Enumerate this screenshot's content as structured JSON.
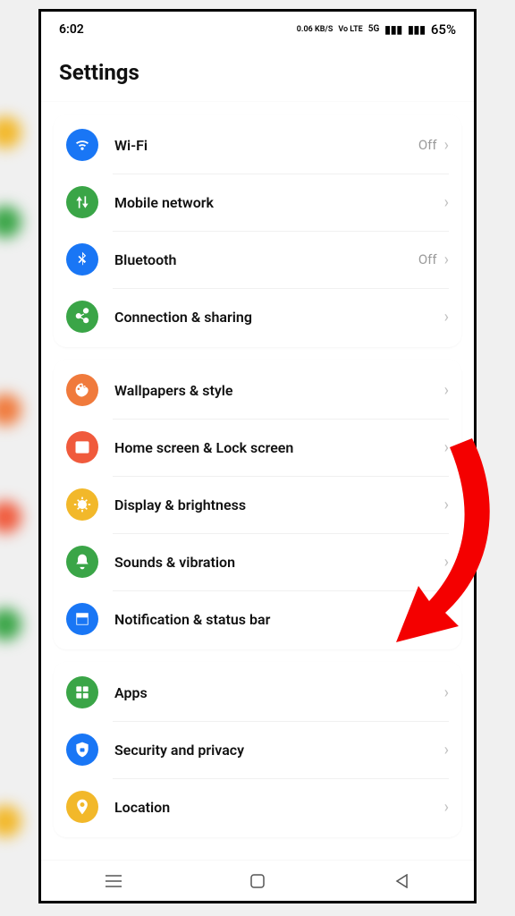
{
  "statusBar": {
    "time": "6:02",
    "netspeed": "0.06 KB/S",
    "volte": "Vo LTE",
    "net": "5G",
    "battery": "65%"
  },
  "header": {
    "title": "Settings"
  },
  "groups": [
    {
      "items": [
        {
          "icon": "wifi-icon",
          "color": "#1976f5",
          "label": "Wi-Fi",
          "value": "Off"
        },
        {
          "icon": "mobile-network-icon",
          "color": "#3aa547",
          "label": "Mobile network",
          "value": ""
        },
        {
          "icon": "bluetooth-icon",
          "color": "#1976f5",
          "label": "Bluetooth",
          "value": "Off"
        },
        {
          "icon": "connection-sharing-icon",
          "color": "#3aa547",
          "label": "Connection & sharing",
          "value": ""
        }
      ]
    },
    {
      "items": [
        {
          "icon": "wallpapers-icon",
          "color": "#f07a3c",
          "label": "Wallpapers & style",
          "value": ""
        },
        {
          "icon": "home-lock-icon",
          "color": "#f05a3c",
          "label": "Home screen & Lock screen",
          "value": ""
        },
        {
          "icon": "display-icon",
          "color": "#f2b82a",
          "label": "Display & brightness",
          "value": ""
        },
        {
          "icon": "sounds-icon",
          "color": "#3aa547",
          "label": "Sounds & vibration",
          "value": ""
        },
        {
          "icon": "notification-icon",
          "color": "#1976f5",
          "label": "Notification & status bar",
          "value": ""
        }
      ]
    },
    {
      "items": [
        {
          "icon": "apps-icon",
          "color": "#3aa547",
          "label": "Apps",
          "value": ""
        },
        {
          "icon": "security-icon",
          "color": "#1976f5",
          "label": "Security and privacy",
          "value": ""
        },
        {
          "icon": "location-icon",
          "color": "#f2b82a",
          "label": "Location",
          "value": ""
        }
      ]
    }
  ]
}
